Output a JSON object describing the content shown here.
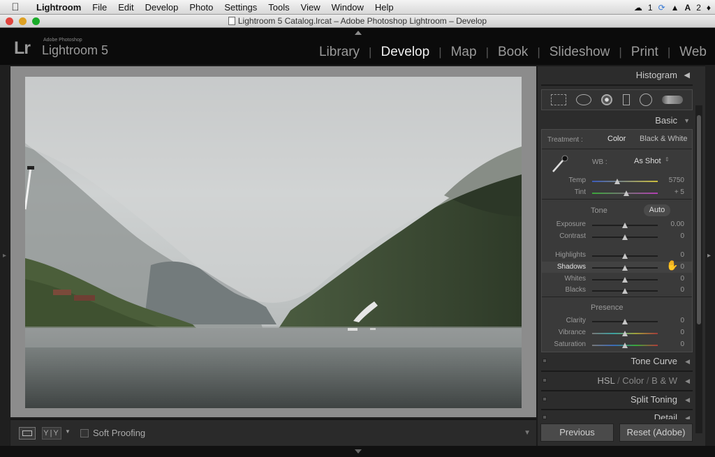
{
  "menubar": {
    "items": [
      "Lightroom",
      "File",
      "Edit",
      "Develop",
      "Photo",
      "Settings",
      "Tools",
      "View",
      "Window",
      "Help"
    ],
    "tray": {
      "cloud_count": "1",
      "adobe_count": "2"
    }
  },
  "window": {
    "title": "Lightroom 5 Catalog.lrcat – Adobe Photoshop Lightroom – Develop"
  },
  "header": {
    "brand_small": "Adobe Photoshop",
    "brand_logo": "Lr",
    "product": "Lightroom 5",
    "modules": [
      "Library",
      "Develop",
      "Map",
      "Book",
      "Slideshow",
      "Print",
      "Web"
    ],
    "active_module": "Develop"
  },
  "toolbar": {
    "before_after": "Y|Y",
    "soft_proofing": "Soft Proofing"
  },
  "panels": {
    "histogram": "Histogram",
    "basic": "Basic",
    "tone_curve": "Tone Curve",
    "hsl": {
      "hsl": "HSL",
      "slash": "/",
      "color": "Color",
      "bw": "B & W"
    },
    "split_toning": "Split Toning",
    "detail": "Detail"
  },
  "basic": {
    "treatment_label": "Treatment :",
    "treatment_color": "Color",
    "treatment_bw": "Black & White",
    "wb_label": "WB :",
    "wb_value": "As Shot",
    "tone_label": "Tone",
    "auto": "Auto",
    "presence_label": "Presence",
    "temp": {
      "label": "Temp",
      "value": "5750",
      "pos": 0.38
    },
    "tint": {
      "label": "Tint",
      "value": "+ 5",
      "pos": 0.52
    },
    "exposure": {
      "label": "Exposure",
      "value": "0.00",
      "pos": 0.5
    },
    "contrast": {
      "label": "Contrast",
      "value": "0",
      "pos": 0.5
    },
    "highlights": {
      "label": "Highlights",
      "value": "0",
      "pos": 0.5
    },
    "shadows": {
      "label": "Shadows",
      "value": "0",
      "pos": 0.5
    },
    "whites": {
      "label": "Whites",
      "value": "0",
      "pos": 0.5
    },
    "blacks": {
      "label": "Blacks",
      "value": "0",
      "pos": 0.5
    },
    "clarity": {
      "label": "Clarity",
      "value": "0",
      "pos": 0.5
    },
    "vibrance": {
      "label": "Vibrance",
      "value": "0",
      "pos": 0.5
    },
    "saturation": {
      "label": "Saturation",
      "value": "0",
      "pos": 0.5
    }
  },
  "buttons": {
    "previous": "Previous",
    "reset": "Reset (Adobe)"
  }
}
